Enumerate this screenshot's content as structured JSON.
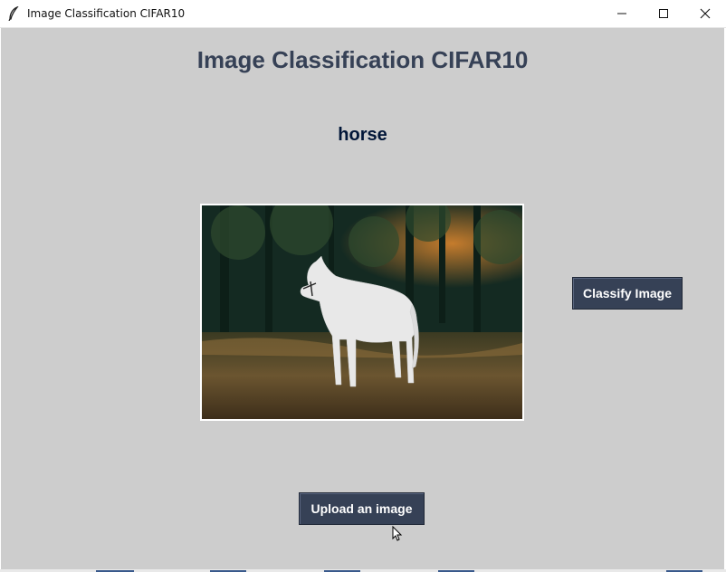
{
  "window": {
    "title": "Image Classification CIFAR10",
    "icon": "feather-icon",
    "controls": [
      "minimize-icon",
      "maximize-icon",
      "close-icon"
    ]
  },
  "app": {
    "heading": "Image Classification CIFAR10",
    "prediction": "horse",
    "image": {
      "subject": "horse",
      "icon": "horse-photo"
    },
    "classify_button": "Classify Image",
    "upload_button": "Upload an image"
  },
  "colors": {
    "background": "#cdcdcd",
    "heading_text": "#364156",
    "prediction_text": "#011638",
    "button_bg": "#364156",
    "button_text": "#ffffff"
  }
}
